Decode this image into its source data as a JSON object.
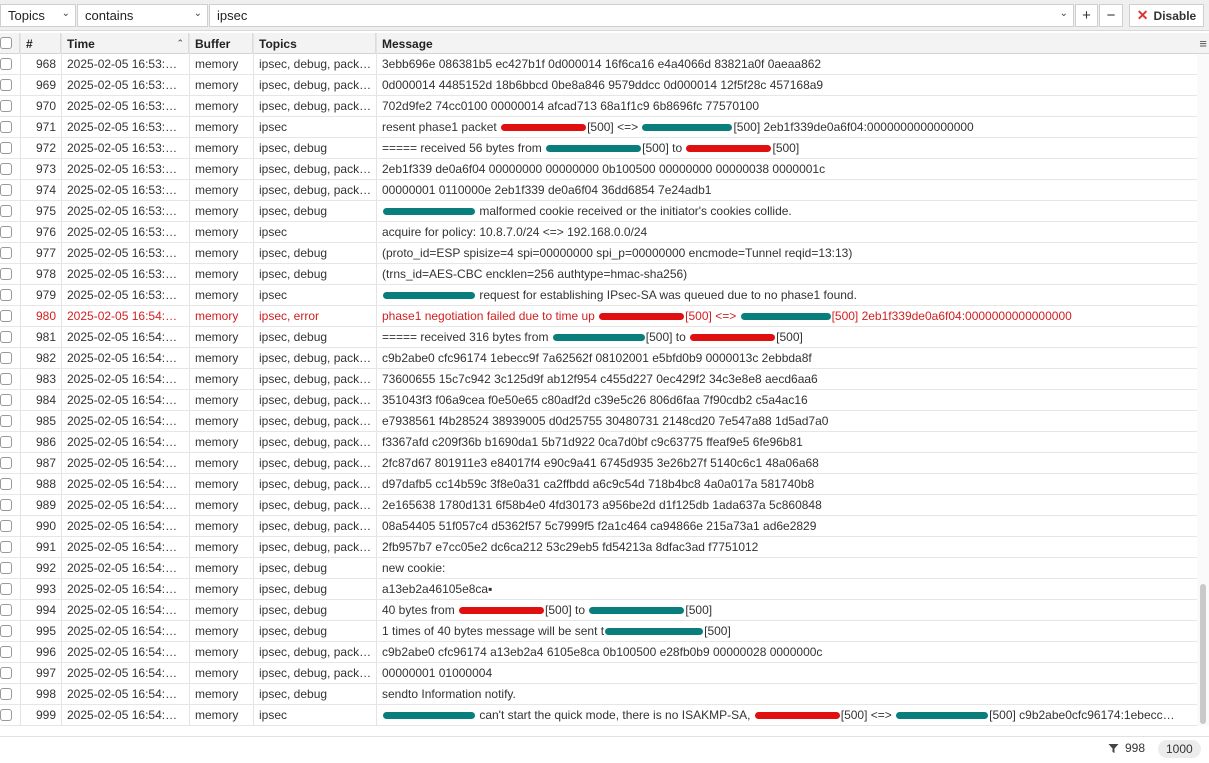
{
  "filter": {
    "field": "Topics",
    "operator": "contains",
    "value": "ipsec",
    "add_label": "+",
    "remove_label": "−",
    "disable_label": "Disable"
  },
  "columns": [
    "#",
    "Time",
    "Buffer",
    "Topics",
    "Message"
  ],
  "rows": [
    {
      "num": "968",
      "time": "2025-02-05 16:53:…",
      "buffer": "memory",
      "topics": "ipsec, debug, pack…",
      "msg": [
        "3ebb696e 086381b5 ec427b1f 0d000014 16f6ca16 e4a4066d 83821a0f 0aeaa862"
      ]
    },
    {
      "num": "969",
      "time": "2025-02-05 16:53:…",
      "buffer": "memory",
      "topics": "ipsec, debug, pack…",
      "msg": [
        "0d000014 4485152d 18b6bbcd 0be8a846 9579ddcc 0d000014 12f5f28c 457168a9"
      ]
    },
    {
      "num": "970",
      "time": "2025-02-05 16:53:…",
      "buffer": "memory",
      "topics": "ipsec, debug, pack…",
      "msg": [
        "702d9fe2 74cc0100 00000014 afcad713 68a1f1c9 6b8696fc 77570100"
      ]
    },
    {
      "num": "971",
      "time": "2025-02-05 16:53:…",
      "buffer": "memory",
      "topics": "ipsec",
      "msg": [
        "resent phase1 packet ",
        {
          "r": "red",
          "w": 85
        },
        "[500] <=> ",
        {
          "r": "teal",
          "w": 90
        },
        "[500] 2eb1f339de0a6f04:0000000000000000"
      ]
    },
    {
      "num": "972",
      "time": "2025-02-05 16:53:…",
      "buffer": "memory",
      "topics": "ipsec, debug",
      "msg": [
        "===== received 56 bytes from ",
        {
          "r": "teal",
          "w": 95
        },
        "[500] to ",
        {
          "r": "red",
          "w": 85
        },
        "[500]"
      ]
    },
    {
      "num": "973",
      "time": "2025-02-05 16:53:…",
      "buffer": "memory",
      "topics": "ipsec, debug, pack…",
      "msg": [
        "2eb1f339 de0a6f04 00000000 00000000 0b100500 00000000 00000038 0000001c"
      ]
    },
    {
      "num": "974",
      "time": "2025-02-05 16:53:…",
      "buffer": "memory",
      "topics": "ipsec, debug, pack…",
      "msg": [
        "00000001 0110000e 2eb1f339 de0a6f04 36dd6854 7e24adb1"
      ]
    },
    {
      "num": "975",
      "time": "2025-02-05 16:53:…",
      "buffer": "memory",
      "topics": "ipsec, debug",
      "msg": [
        {
          "r": "teal",
          "w": 92
        },
        " malformed cookie received or the initiator's cookies collide."
      ]
    },
    {
      "num": "976",
      "time": "2025-02-05 16:53:…",
      "buffer": "memory",
      "topics": "ipsec",
      "msg": [
        "acquire for policy: 10.8.7.0/24 <=> 192.168.0.0/24"
      ]
    },
    {
      "num": "977",
      "time": "2025-02-05 16:53:…",
      "buffer": "memory",
      "topics": "ipsec, debug",
      "msg": [
        " (proto_id=ESP spisize=4 spi=00000000 spi_p=00000000 encmode=Tunnel reqid=13:13)"
      ]
    },
    {
      "num": "978",
      "time": "2025-02-05 16:53:…",
      "buffer": "memory",
      "topics": "ipsec, debug",
      "msg": [
        "  (trns_id=AES-CBC encklen=256 authtype=hmac-sha256)"
      ]
    },
    {
      "num": "979",
      "time": "2025-02-05 16:53:…",
      "buffer": "memory",
      "topics": "ipsec",
      "msg": [
        {
          "r": "teal",
          "w": 92
        },
        " request for establishing IPsec-SA was queued due to no phase1 found."
      ]
    },
    {
      "num": "980",
      "time": "2025-02-05 16:54:…",
      "buffer": "memory",
      "topics": "ipsec, error",
      "error": true,
      "msg": [
        "phase1 negotiation failed due to time up ",
        {
          "r": "red",
          "w": 85
        },
        "[500] <=> ",
        {
          "r": "teal",
          "w": 90
        },
        "[500] 2eb1f339de0a6f04:0000000000000000"
      ]
    },
    {
      "num": "981",
      "time": "2025-02-05 16:54:…",
      "buffer": "memory",
      "topics": "ipsec, debug",
      "msg": [
        "===== received 316 bytes from ",
        {
          "r": "teal",
          "w": 92
        },
        "[500] to ",
        {
          "r": "red",
          "w": 85
        },
        "[500]"
      ]
    },
    {
      "num": "982",
      "time": "2025-02-05 16:54:…",
      "buffer": "memory",
      "topics": "ipsec, debug, pack…",
      "msg": [
        "c9b2abe0 cfc96174 1ebecc9f 7a62562f 08102001 e5bfd0b9 0000013c 2ebbda8f"
      ]
    },
    {
      "num": "983",
      "time": "2025-02-05 16:54:…",
      "buffer": "memory",
      "topics": "ipsec, debug, pack…",
      "msg": [
        "73600655 15c7c942 3c125d9f ab12f954 c455d227 0ec429f2 34c3e8e8 aecd6aa6"
      ]
    },
    {
      "num": "984",
      "time": "2025-02-05 16:54:…",
      "buffer": "memory",
      "topics": "ipsec, debug, pack…",
      "msg": [
        "351043f3 f06a9cea f0e50e65 c80adf2d c39e5c26 806d6faa 7f90cdb2 c5a4ac16"
      ]
    },
    {
      "num": "985",
      "time": "2025-02-05 16:54:…",
      "buffer": "memory",
      "topics": "ipsec, debug, pack…",
      "msg": [
        "e7938561 f4b28524 38939005 d0d25755 30480731 2148cd20 7e547a88 1d5ad7a0"
      ]
    },
    {
      "num": "986",
      "time": "2025-02-05 16:54:…",
      "buffer": "memory",
      "topics": "ipsec, debug, pack…",
      "msg": [
        "f3367afd c209f36b b1690da1 5b71d922 0ca7d0bf c9c63775 ffeaf9e5 6fe96b81"
      ]
    },
    {
      "num": "987",
      "time": "2025-02-05 16:54:…",
      "buffer": "memory",
      "topics": "ipsec, debug, pack…",
      "msg": [
        "2fc87d67 801911e3 e84017f4 e90c9a41 6745d935 3e26b27f 5140c6c1 48a06a68"
      ]
    },
    {
      "num": "988",
      "time": "2025-02-05 16:54:…",
      "buffer": "memory",
      "topics": "ipsec, debug, pack…",
      "msg": [
        "d97dafb5 cc14b59c 3f8e0a31 ca2ffbdd a6c9c54d 718b4bc8 4a0a017a 581740b8"
      ]
    },
    {
      "num": "989",
      "time": "2025-02-05 16:54:…",
      "buffer": "memory",
      "topics": "ipsec, debug, pack…",
      "msg": [
        "2e165638 1780d131 6f58b4e0 4fd30173 a956be2d d1f125db 1ada637a 5c860848"
      ]
    },
    {
      "num": "990",
      "time": "2025-02-05 16:54:…",
      "buffer": "memory",
      "topics": "ipsec, debug, pack…",
      "msg": [
        "08a54405 51f057c4 d5362f57 5c7999f5 f2a1c464 ca94866e 215a73a1 ad6e2829"
      ]
    },
    {
      "num": "991",
      "time": "2025-02-05 16:54:…",
      "buffer": "memory",
      "topics": "ipsec, debug, pack…",
      "msg": [
        "2fb957b7 e7cc05e2 dc6ca212 53c29eb5 fd54213a 8dfac3ad f7751012"
      ]
    },
    {
      "num": "992",
      "time": "2025-02-05 16:54:…",
      "buffer": "memory",
      "topics": "ipsec, debug",
      "msg": [
        "new cookie:"
      ]
    },
    {
      "num": "993",
      "time": "2025-02-05 16:54:…",
      "buffer": "memory",
      "topics": "ipsec, debug",
      "msg": [
        "a13eb2a46105e8ca▪"
      ]
    },
    {
      "num": "994",
      "time": "2025-02-05 16:54:…",
      "buffer": "memory",
      "topics": "ipsec, debug",
      "msg": [
        "40 bytes from ",
        {
          "r": "red",
          "w": 85
        },
        "[500] to ",
        {
          "r": "teal",
          "w": 95
        },
        "[500]"
      ]
    },
    {
      "num": "995",
      "time": "2025-02-05 16:54:…",
      "buffer": "memory",
      "topics": "ipsec, debug",
      "msg": [
        "1 times of 40 bytes message will be sent t",
        {
          "r": "teal",
          "w": 98
        },
        "[500]"
      ]
    },
    {
      "num": "996",
      "time": "2025-02-05 16:54:…",
      "buffer": "memory",
      "topics": "ipsec, debug, pack…",
      "msg": [
        "c9b2abe0 cfc96174 a13eb2a4 6105e8ca 0b100500 e28fb0b9 00000028 0000000c"
      ]
    },
    {
      "num": "997",
      "time": "2025-02-05 16:54:…",
      "buffer": "memory",
      "topics": "ipsec, debug, pack…",
      "msg": [
        "00000001 01000004"
      ]
    },
    {
      "num": "998",
      "time": "2025-02-05 16:54:…",
      "buffer": "memory",
      "topics": "ipsec, debug",
      "msg": [
        "sendto Information notify."
      ]
    },
    {
      "num": "999",
      "time": "2025-02-05 16:54:…",
      "buffer": "memory",
      "topics": "ipsec",
      "msg": [
        {
          "r": "teal",
          "w": 92
        },
        " can't start the quick mode, there is no ISAKMP-SA, ",
        {
          "r": "red",
          "w": 85
        },
        "[500] <=> ",
        {
          "r": "teal",
          "w": 92
        },
        "[500] c9b2abe0cfc96174:1ebecc…"
      ]
    }
  ],
  "status": {
    "filtered_count": "998",
    "total_count": "1000"
  },
  "colors": {
    "error": "#d32020",
    "redact_red": "#e01010",
    "redact_teal": "#0a7d7d"
  }
}
